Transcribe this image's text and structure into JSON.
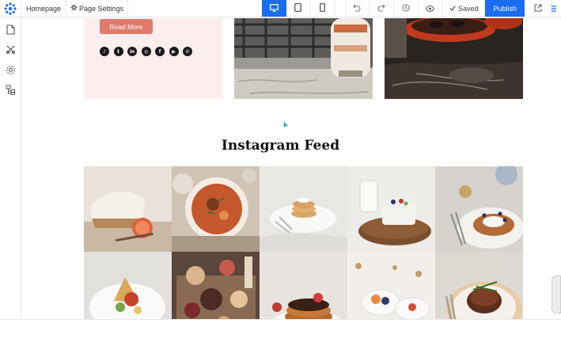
{
  "toolbar": {
    "page_name": "Homepage",
    "page_settings_label": "Page Settings",
    "saved_label": "Saved",
    "publish_label": "Publish",
    "icons": [
      "logo-icon",
      "gear-icon",
      "desktop-icon",
      "tablet-icon",
      "mobile-icon",
      "undo-icon",
      "redo-icon",
      "history-icon",
      "preview-eye-icon",
      "check-icon",
      "external-link-icon",
      "menu-icon"
    ]
  },
  "sidebar": {
    "icons": [
      "pages-icon",
      "elements-icon",
      "settings-icon",
      "layers-icon"
    ]
  },
  "content": {
    "read_more_label": "Read More",
    "social_icons": [
      "tiktok-icon",
      "twitter-icon",
      "linkedin-icon",
      "instagram-icon",
      "facebook-icon",
      "youtube-icon",
      "whatsapp-icon"
    ],
    "social_glyphs": [
      "♪",
      "t",
      "in",
      "◎",
      "f",
      "▶",
      "✆"
    ],
    "feed_title": "Instagram Feed"
  },
  "colors": {
    "accent": "#1a6cf0",
    "button": "#e07b6c",
    "card_bg": "#fdeeee"
  }
}
